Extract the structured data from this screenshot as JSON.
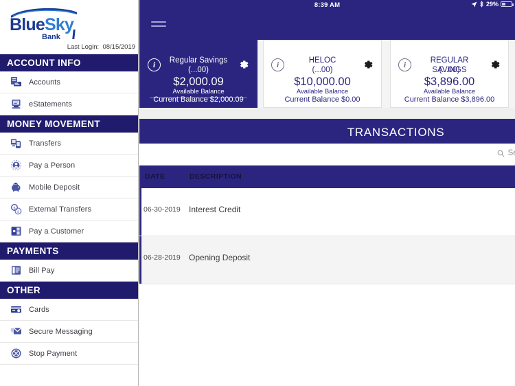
{
  "status_bar": {
    "time": "8:39 AM",
    "battery_percent": "29%",
    "location_icon": "location-arrow-icon",
    "bluetooth_icon": "bluetooth-icon",
    "battery_icon": "battery-icon"
  },
  "navbar": {
    "menu_icon": "hamburger-menu-icon"
  },
  "sidebar": {
    "logo": {
      "part1": "Blue",
      "part2": "Sky",
      "subtitle": "Bank"
    },
    "last_login_label": "Last Login:",
    "last_login_date": "08/15/2019",
    "sections": [
      {
        "title": "ACCOUNT INFO",
        "items": [
          {
            "label": "Accounts",
            "icon": "accounts-icon"
          },
          {
            "label": "eStatements",
            "icon": "estatements-icon"
          }
        ]
      },
      {
        "title": "MONEY MOVEMENT",
        "items": [
          {
            "label": "Transfers",
            "icon": "transfers-icon"
          },
          {
            "label": "Pay a Person",
            "icon": "pay-a-person-icon"
          },
          {
            "label": "Mobile Deposit",
            "icon": "mobile-deposit-icon"
          },
          {
            "label": "External Transfers",
            "icon": "external-transfers-icon"
          },
          {
            "label": "Pay a Customer",
            "icon": "pay-a-customer-icon"
          }
        ]
      },
      {
        "title": "PAYMENTS",
        "items": [
          {
            "label": "Bill Pay",
            "icon": "bill-pay-icon"
          }
        ]
      },
      {
        "title": "OTHER",
        "items": [
          {
            "label": "Cards",
            "icon": "cards-icon"
          },
          {
            "label": "Secure Messaging",
            "icon": "secure-messaging-icon"
          },
          {
            "label": "Stop Payment",
            "icon": "stop-payment-icon"
          }
        ]
      }
    ]
  },
  "accounts": [
    {
      "name": "Regular Savings",
      "mask": "(...00)",
      "available_balance": "$2,000.09",
      "available_label": "Available Balance",
      "current_balance": "Current Balance $2,000.09",
      "selected": true,
      "info_icon": "info-icon",
      "settings_icon": "gear-icon"
    },
    {
      "name": "HELOC",
      "mask": "(...00)",
      "available_balance": "$10,000.00",
      "available_label": "Available Balance",
      "current_balance": "Current Balance $0.00",
      "selected": false,
      "info_icon": "info-icon",
      "settings_icon": "gear-icon"
    },
    {
      "name": "REGULAR SAVINGS",
      "mask": "(...00)",
      "available_balance": "$3,896.00",
      "available_label": "Available Balance",
      "current_balance": "Current Balance $3,896.00",
      "selected": false,
      "info_icon": "info-icon",
      "settings_icon": "gear-icon"
    }
  ],
  "transactions_panel": {
    "title": "TRANSACTIONS",
    "search_placeholder": "Search",
    "search_value": "",
    "search_icon": "search-icon",
    "columns": {
      "date": "DATE",
      "description": "DESCRIPTION"
    },
    "rows": [
      {
        "date": "06-30-2019",
        "description": "Interest Credit"
      },
      {
        "date": "06-28-2019",
        "description": "Opening Deposit"
      }
    ]
  },
  "colors": {
    "brand_navy": "#2b2580",
    "section_navy": "#211b6e",
    "logo_blue": "#1b3a93",
    "logo_sky": "#2f7fd1",
    "row_alt": "#f4f4f4"
  }
}
